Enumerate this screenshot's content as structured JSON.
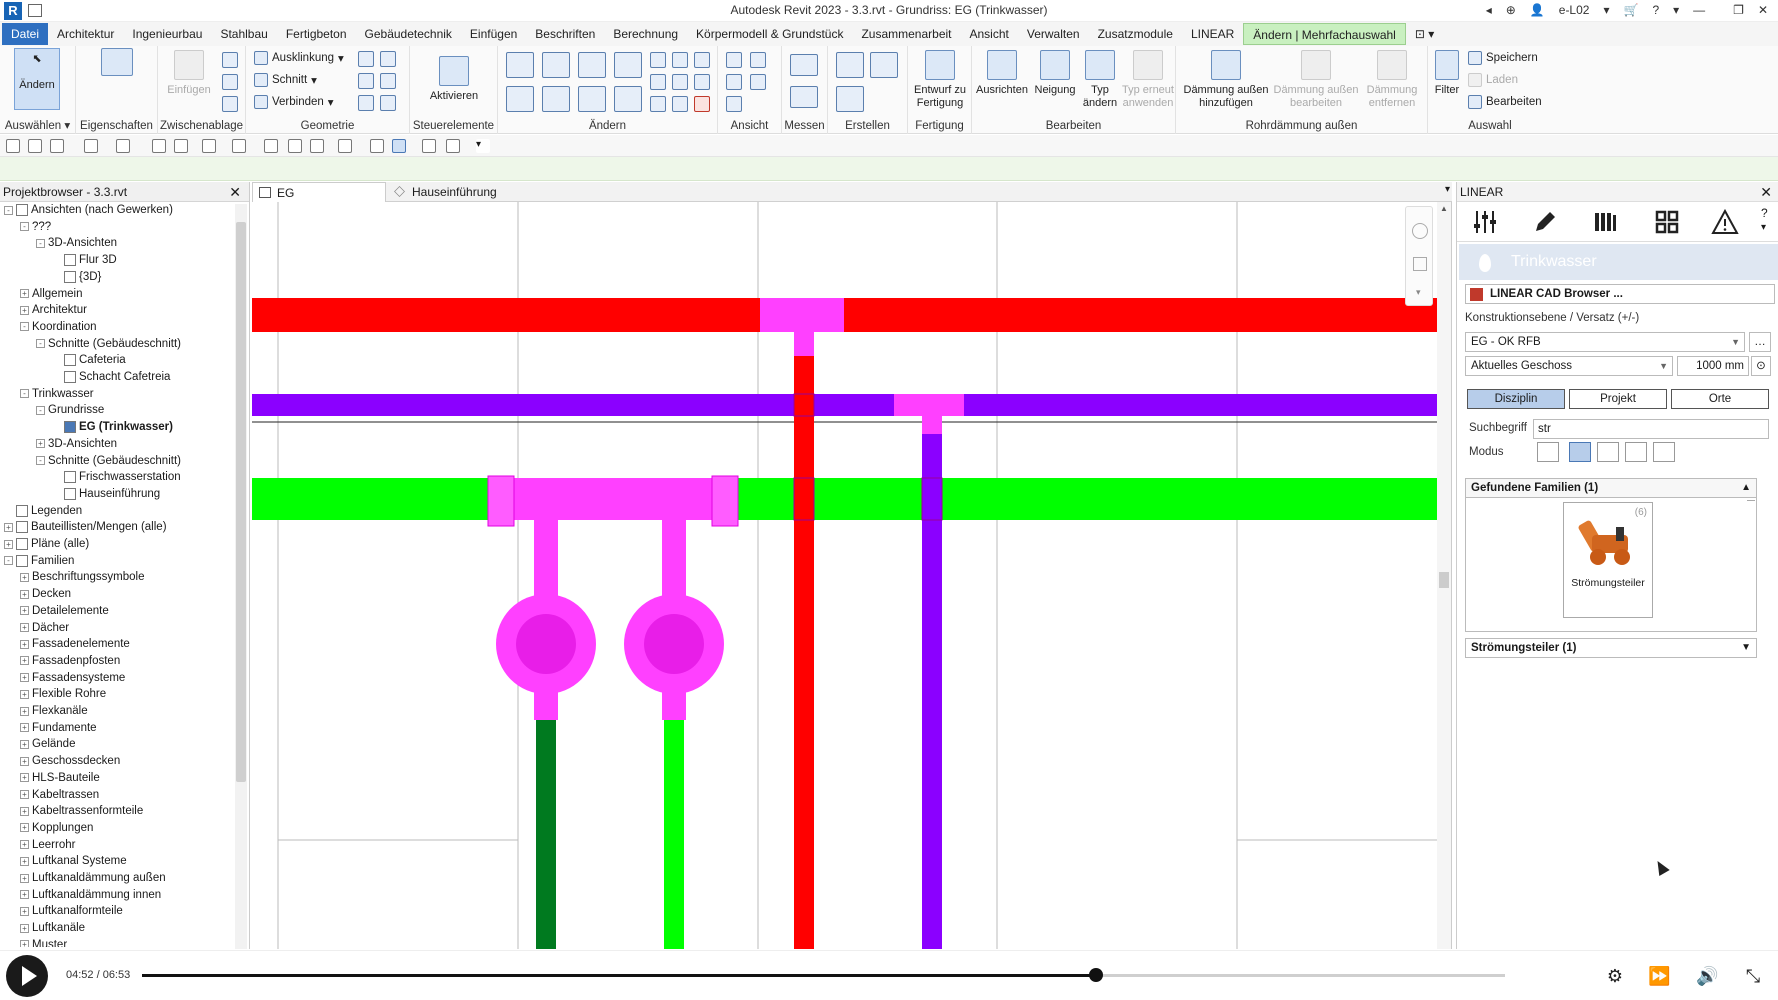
{
  "window": {
    "title": "Autodesk Revit 2023 - 3.3.rvt - Grundriss: EG (Trinkwasser)",
    "user": "e-L02",
    "app_icon_letter": "R"
  },
  "ribbon_tabs": [
    "Datei",
    "Architektur",
    "Ingenieurbau",
    "Stahlbau",
    "Fertigbeton",
    "Gebäudetechnik",
    "Einfügen",
    "Beschriften",
    "Berechnung",
    "Körpermodell & Grundstück",
    "Zusammenarbeit",
    "Ansicht",
    "Verwalten",
    "Zusatzmodule",
    "LINEAR",
    "Ändern | Mehrfachauswahl"
  ],
  "ribbon": {
    "aendern": "Ändern",
    "auswaehlen": "Auswählen ▾",
    "eigenschaften": "Eigenschaften",
    "einfuegen": "Einfügen",
    "zwischenablage": "Zwischenablage",
    "ausklinkung": "Ausklinkung",
    "schnitt": "Schnitt",
    "verbinden": "Verbinden",
    "geometrie": "Geometrie",
    "aktivieren": "Aktivieren",
    "steuerelemente": "Steuerelemente",
    "aendern_group": "Ändern",
    "ansicht": "Ansicht",
    "messen": "Messen",
    "erstellen": "Erstellen",
    "entwurf_fertigung": "Entwurf zu Fertigung",
    "fertigung": "Fertigung",
    "ausrichten": "Ausrichten",
    "neigung": "Neigung",
    "typ_aendern": "Typ ändern",
    "typ_erneut": "Typ erneut anwenden",
    "bearbeiten_group": "Bearbeiten",
    "daemmung_hinzu": "Dämmung außen hinzufügen",
    "daemmung_bearb": "Dämmung außen bearbeiten",
    "daemmung_entf": "Dämmung entfernen",
    "rohrdaemmung": "Rohrdämmung außen",
    "filter": "Filter",
    "speichern": "Speichern",
    "laden": "Laden",
    "bearbeiten": "Bearbeiten",
    "auswahl": "Auswahl"
  },
  "project_browser": {
    "title": "Projektbrowser - 3.3.rvt",
    "nodes": [
      {
        "label": "Ansichten (nach Gewerken)",
        "level": 0,
        "exp": "-"
      },
      {
        "label": "???",
        "level": 1,
        "exp": "-"
      },
      {
        "label": "3D-Ansichten",
        "level": 2,
        "exp": "-"
      },
      {
        "label": "Flur 3D",
        "level": 3,
        "exp": ""
      },
      {
        "label": "{3D}",
        "level": 3,
        "exp": ""
      },
      {
        "label": "Allgemein",
        "level": 1,
        "exp": "+"
      },
      {
        "label": "Architektur",
        "level": 1,
        "exp": "+"
      },
      {
        "label": "Koordination",
        "level": 1,
        "exp": "-"
      },
      {
        "label": "Schnitte (Gebäudeschnitt)",
        "level": 2,
        "exp": "-"
      },
      {
        "label": "Cafeteria",
        "level": 3,
        "exp": ""
      },
      {
        "label": "Schacht Cafetreia",
        "level": 3,
        "exp": ""
      },
      {
        "label": "Trinkwasser",
        "level": 1,
        "exp": "-"
      },
      {
        "label": "Grundrisse",
        "level": 2,
        "exp": "-"
      },
      {
        "label": "EG (Trinkwasser)",
        "level": 3,
        "exp": "",
        "bold": true
      },
      {
        "label": "3D-Ansichten",
        "level": 2,
        "exp": "+"
      },
      {
        "label": "Schnitte (Gebäudeschnitt)",
        "level": 2,
        "exp": "-"
      },
      {
        "label": "Frischwasserstation",
        "level": 3,
        "exp": ""
      },
      {
        "label": "Hauseinführung",
        "level": 3,
        "exp": ""
      },
      {
        "label": "Legenden",
        "level": 0,
        "exp": ""
      },
      {
        "label": "Bauteillisten/Mengen (alle)",
        "level": 0,
        "exp": "+"
      },
      {
        "label": "Pläne (alle)",
        "level": 0,
        "exp": "+"
      },
      {
        "label": "Familien",
        "level": 0,
        "exp": "-"
      },
      {
        "label": "Beschriftungssymbole",
        "level": 1,
        "exp": "+"
      },
      {
        "label": "Decken",
        "level": 1,
        "exp": "+"
      },
      {
        "label": "Detailelemente",
        "level": 1,
        "exp": "+"
      },
      {
        "label": "Dächer",
        "level": 1,
        "exp": "+"
      },
      {
        "label": "Fassadenelemente",
        "level": 1,
        "exp": "+"
      },
      {
        "label": "Fassadenpfosten",
        "level": 1,
        "exp": "+"
      },
      {
        "label": "Fassadensysteme",
        "level": 1,
        "exp": "+"
      },
      {
        "label": "Flexible Rohre",
        "level": 1,
        "exp": "+"
      },
      {
        "label": "Flexkanäle",
        "level": 1,
        "exp": "+"
      },
      {
        "label": "Fundamente",
        "level": 1,
        "exp": "+"
      },
      {
        "label": "Gelände",
        "level": 1,
        "exp": "+"
      },
      {
        "label": "Geschossdecken",
        "level": 1,
        "exp": "+"
      },
      {
        "label": "HLS-Bauteile",
        "level": 1,
        "exp": "+"
      },
      {
        "label": "Kabeltrassen",
        "level": 1,
        "exp": "+"
      },
      {
        "label": "Kabeltrassenformteile",
        "level": 1,
        "exp": "+"
      },
      {
        "label": "Kopplungen",
        "level": 1,
        "exp": "+"
      },
      {
        "label": "Leerrohr",
        "level": 1,
        "exp": "+"
      },
      {
        "label": "Luftkanal Systeme",
        "level": 1,
        "exp": "+"
      },
      {
        "label": "Luftkanaldämmung außen",
        "level": 1,
        "exp": "+"
      },
      {
        "label": "Luftkanaldämmung innen",
        "level": 1,
        "exp": "+"
      },
      {
        "label": "Luftkanalformteile",
        "level": 1,
        "exp": "+"
      },
      {
        "label": "Luftkanäle",
        "level": 1,
        "exp": "+"
      },
      {
        "label": "Muster",
        "level": 1,
        "exp": "+"
      }
    ]
  },
  "view_tabs": [
    "EG (Trinkwasser)",
    "Hauseinführung"
  ],
  "linear_panel": {
    "title": "LINEAR",
    "banner": "Trinkwasser",
    "cad_browser": "LINEAR CAD Browser ...",
    "konstruktionsebene_label": "Konstruktionsebene / Versatz (+/-)",
    "ebene_value": "EG - OK RFB",
    "geschoss_value": "Aktuelles Geschoss",
    "versatz_value": "1000 mm",
    "segments": [
      "Disziplin",
      "Projekt",
      "Orte"
    ],
    "suchbegriff_label": "Suchbegriff",
    "suchbegriff_value": "str",
    "modus_label": "Modus",
    "found_header": "Gefundene Familien (1)",
    "family_name": "Strömungsteiler",
    "family_count": "(6)",
    "family_dropdown": "Strömungsteiler (1)"
  },
  "player": {
    "time": "04:52 / 06:53",
    "progress": 0.7
  }
}
